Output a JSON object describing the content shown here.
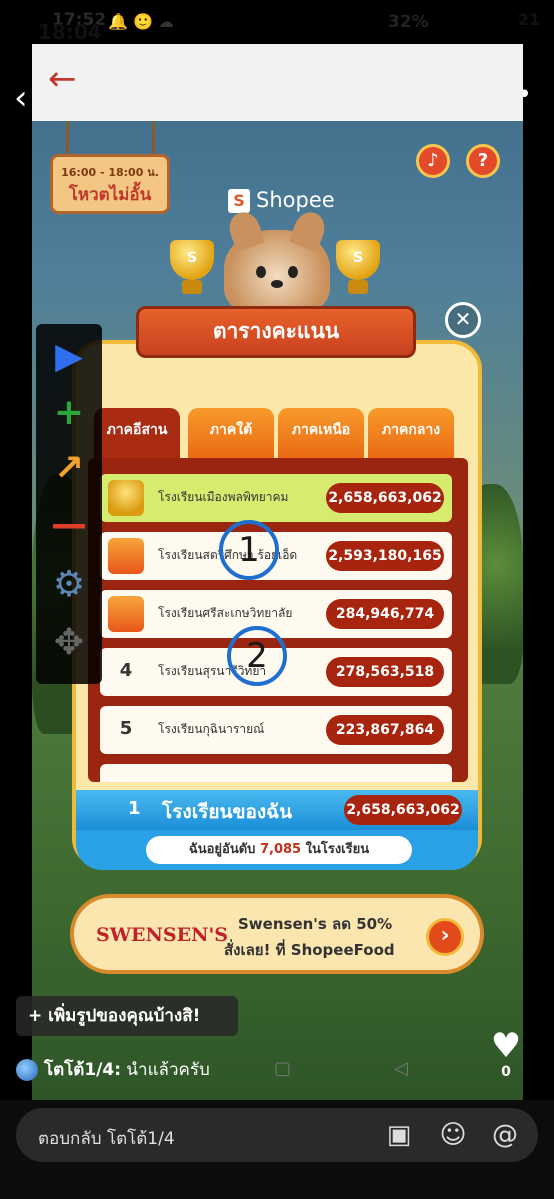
{
  "status_bar": {
    "time_back": "17:52",
    "time_front": "18:04",
    "battery_percent": "32%",
    "battery_level_front": "21"
  },
  "game": {
    "promo": {
      "time": "16:00 - 18:00 น.",
      "title": "โหวตไม่อั้น"
    },
    "brand": "Shopee",
    "trophy_letter": "S",
    "sound_icon": "speaker-icon",
    "help_label": "?",
    "leaderboard_title": "ตารางคะแนน",
    "tabs": [
      {
        "label": "ภาคอีสาน",
        "active": true
      },
      {
        "label": "ภาคใต้",
        "active": false
      },
      {
        "label": "ภาคเหนือ",
        "active": false
      },
      {
        "label": "ภาคกลาง",
        "active": false
      }
    ],
    "rows": [
      {
        "rank": "",
        "medal": "gold",
        "school": "โรงเรียนเมืองพลพิทยาคม",
        "score": "2,658,663,062"
      },
      {
        "rank": "",
        "medal": "box",
        "school": "โรงเรียนสตรีศึกษา ร้อยเอ็ด",
        "score": "2,593,180,165"
      },
      {
        "rank": "",
        "medal": "box",
        "school": "โรงเรียนศรีสะเกษวิทยาลัย",
        "score": "284,946,774"
      },
      {
        "rank": "4",
        "medal": "",
        "school": "โรงเรียนสุรนารีวิทยา",
        "score": "278,563,518"
      },
      {
        "rank": "5",
        "medal": "",
        "school": "โรงเรียนกุฉินารายณ์",
        "score": "223,867,864"
      }
    ],
    "my_school": {
      "rank": "1",
      "label": "โรงเรียนของฉัน",
      "score": "2,658,663,062",
      "position_prefix": "ฉันอยู่อันดับ",
      "position_number": "7,085",
      "position_suffix": "ในโรงเรียน"
    },
    "ad": {
      "logo": "SWENSEN'S",
      "line1": "Swensen's ลด 50%",
      "line2": "สั่งเลย! ที่ ShopeeFood"
    }
  },
  "overlay": {
    "toolbar_icons": [
      "play-icon",
      "plus-icon",
      "redo-arrow-icon",
      "minus-icon",
      "gear-icon",
      "move-icon"
    ],
    "markers": [
      "1",
      "2"
    ]
  },
  "chat": {
    "add_photo": "+ เพิ่มรูปของคุณบ้างสิ!",
    "like_count": "0",
    "comment_author": "โตโต้1/4:",
    "comment_text": " นำแล้วครับ",
    "reply_placeholder": "ตอบกลับ โตโต้1/4"
  }
}
